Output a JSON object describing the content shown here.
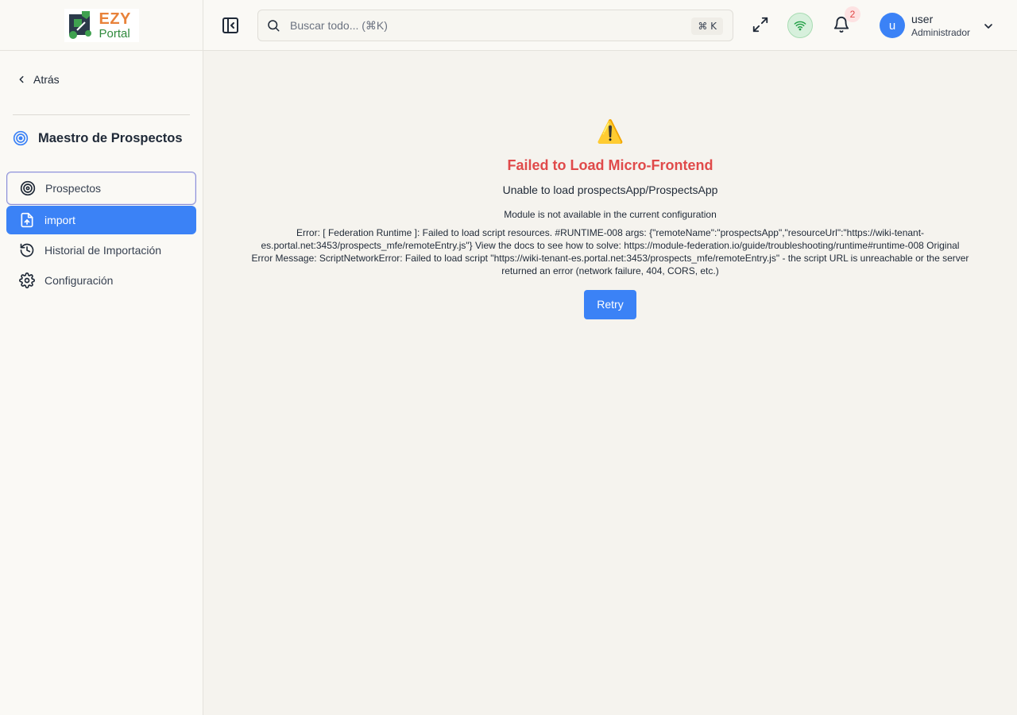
{
  "logo": {
    "text_top": "EZY",
    "text_bottom": "Portal"
  },
  "sidebar": {
    "back_label": "Atrás",
    "section_title": "Maestro de Prospectos",
    "items": [
      {
        "label": "Prospectos",
        "icon": "target-icon",
        "state": "focused"
      },
      {
        "label": "import",
        "icon": "file-upload-icon",
        "state": "active"
      },
      {
        "label": "Historial de Importación",
        "icon": "history-icon",
        "state": "normal"
      },
      {
        "label": "Configuración",
        "icon": "gear-icon",
        "state": "normal"
      }
    ]
  },
  "header": {
    "search_placeholder": "Buscar todo... (⌘K)",
    "shortcut": "⌘ K",
    "notification_count": "2",
    "user_initial": "u",
    "user_name": "user",
    "user_role": "Administrador"
  },
  "error": {
    "icon": "⚠️",
    "title": "Failed to Load Micro-Frontend",
    "subtitle": "Unable to load prospectsApp/ProspectsApp",
    "module_message": "Module is not available in the current configuration",
    "detail": "Error: [ Federation Runtime ]: Failed to load script resources. #RUNTIME-008 args: {\"remoteName\":\"prospectsApp\",\"resourceUrl\":\"https://wiki-tenant-es.portal.net:3453/prospects_mfe/remoteEntry.js\"} View the docs to see how to solve: https://module-federation.io/guide/troubleshooting/runtime#runtime-008 Original Error Message: ScriptNetworkError: Failed to load script \"https://wiki-tenant-es.portal.net:3453/prospects_mfe/remoteEntry.js\" - the script URL is unreachable or the server returned an error (network failure, 404, CORS, etc.)",
    "retry_label": "Retry"
  },
  "colors": {
    "accent": "#3b82f6",
    "error": "#e04a4a",
    "logo_orange": "#e8823a",
    "logo_green": "#2f8a3c",
    "wifi_green": "#22a046"
  }
}
